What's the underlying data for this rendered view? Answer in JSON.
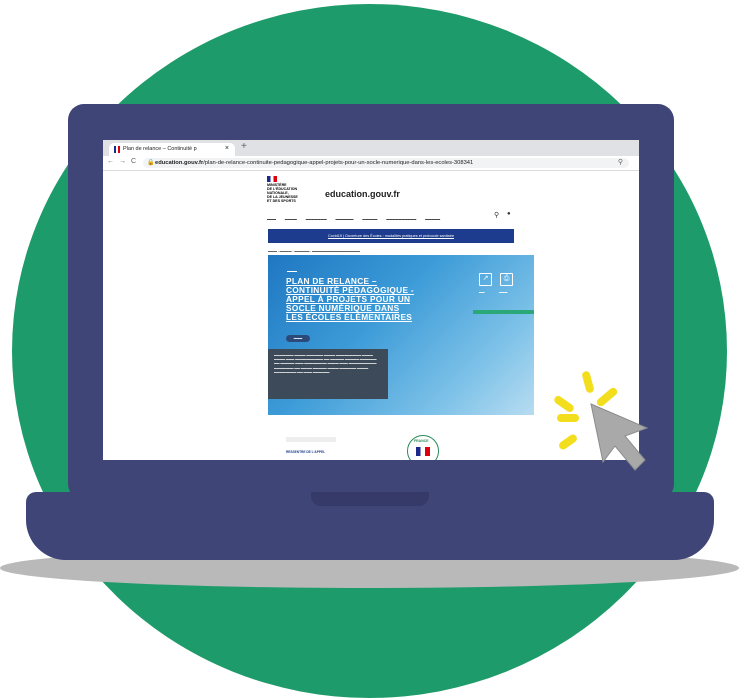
{
  "browser": {
    "tab_title": "Plan de relance – Continuité p",
    "tab_close": "×",
    "new_tab": "+",
    "back": "←",
    "forward": "→",
    "reload": "C",
    "url_domain": "education.gouv.fr",
    "url_path": "/plan-de-relance-continuite-pedagogique-appel-projets-pour-un-socle-numerique-dans-les-ecoles-308341"
  },
  "page": {
    "ministry_lines": [
      "MINISTÈRE",
      "DE L'ÉDUCATION",
      "NATIONALE,",
      "DE LA JEUNESSE",
      "ET DES SPORTS"
    ],
    "site_title": "education.gouv.fr",
    "covid_banner": "Covid19 | Ouverture des Écoles : modalités pratiques et protocole sanitaire",
    "hero_title_lines": [
      "PLAN DE RELANCE –",
      "CONTINUITÉ PÉDAGOGIQUE -",
      "APPEL À PROJETS POUR UN",
      "SOCLE NUMÉRIQUE DANS",
      "LES ÉCOLES ÉLÉMENTAIRES"
    ],
    "bottom_link": "RESSENTRE DE L'APPEL"
  },
  "colors": {
    "circle": "#1e9b6a",
    "laptop": "#3f4577",
    "banner": "#1d3c8d",
    "sparkle": "#f2de1d",
    "cursor": "#a9a9a9"
  },
  "icons": [
    "lock-icon",
    "search-icon",
    "share-icon",
    "print-icon",
    "cursor-icon"
  ]
}
